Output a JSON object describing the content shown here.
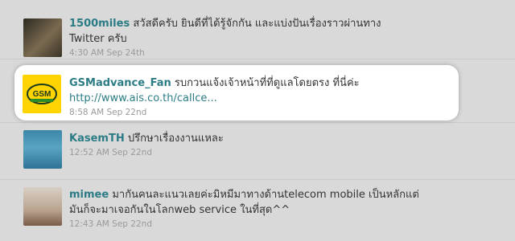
{
  "tweets": [
    {
      "user": "1500miles",
      "text_line1": "สวัสดีครับ ยินดีที่ได้รู้จักกัน และแบ่งปันเรื่องราวผ่านทาง",
      "text_line2": "Twitter ครับ",
      "time": "4:30 AM Sep 24th"
    },
    {
      "user": "GSMadvance_Fan",
      "text_line1": "รบกวนแจ้งเจ้าหน้าที่ที่ดูแลโดยตรง ที่นี่ค่ะ",
      "link": "http://www.ais.co.th/callce...",
      "time": "8:58 AM Sep 22nd",
      "logo_text": "GSM"
    },
    {
      "user": "KasemTH",
      "text_line1": "ปรึกษาเรื่องงานแหละ",
      "time": "12:52 AM Sep 22nd"
    },
    {
      "user": "mimee",
      "text_line1": "มากันคนละแนวเลยค่ะมิหมีมาทางด้านtelecom mobile เป็นหลักแต่",
      "text_line2": "มันก็จะมาเจอกันในโลกweb service ในที่สุด^^",
      "time": "12:43 AM Sep 22nd"
    }
  ],
  "colors": {
    "username": "#2c7c86",
    "text": "#333333",
    "meta": "#9a9a9a",
    "highlight_card": "#ffffff",
    "background": "#d9d9d9",
    "gsm_yellow": "#ffd400"
  }
}
